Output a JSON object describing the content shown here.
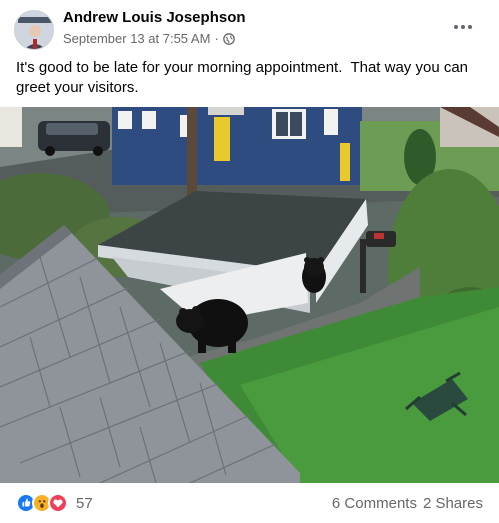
{
  "post": {
    "author": "Andrew Louis Josephson",
    "timestamp": "September 13 at 7:55 AM",
    "separator": "·",
    "privacy_icon": "globe-icon",
    "more_icon": "ellipsis-icon",
    "text": "It's good to be late for your morning appointment.  That way you can greet your visitors.",
    "photo_description_icon": "photo"
  },
  "footer": {
    "reactions": [
      "like-icon",
      "wow-icon",
      "love-icon"
    ],
    "reaction_count": "57",
    "comments": "6 Comments",
    "shares": "2 Shares"
  },
  "colors": {
    "like": "#1877f2",
    "wow": "#f7b125",
    "love": "#f33e58",
    "secondary_text": "#65676b"
  }
}
